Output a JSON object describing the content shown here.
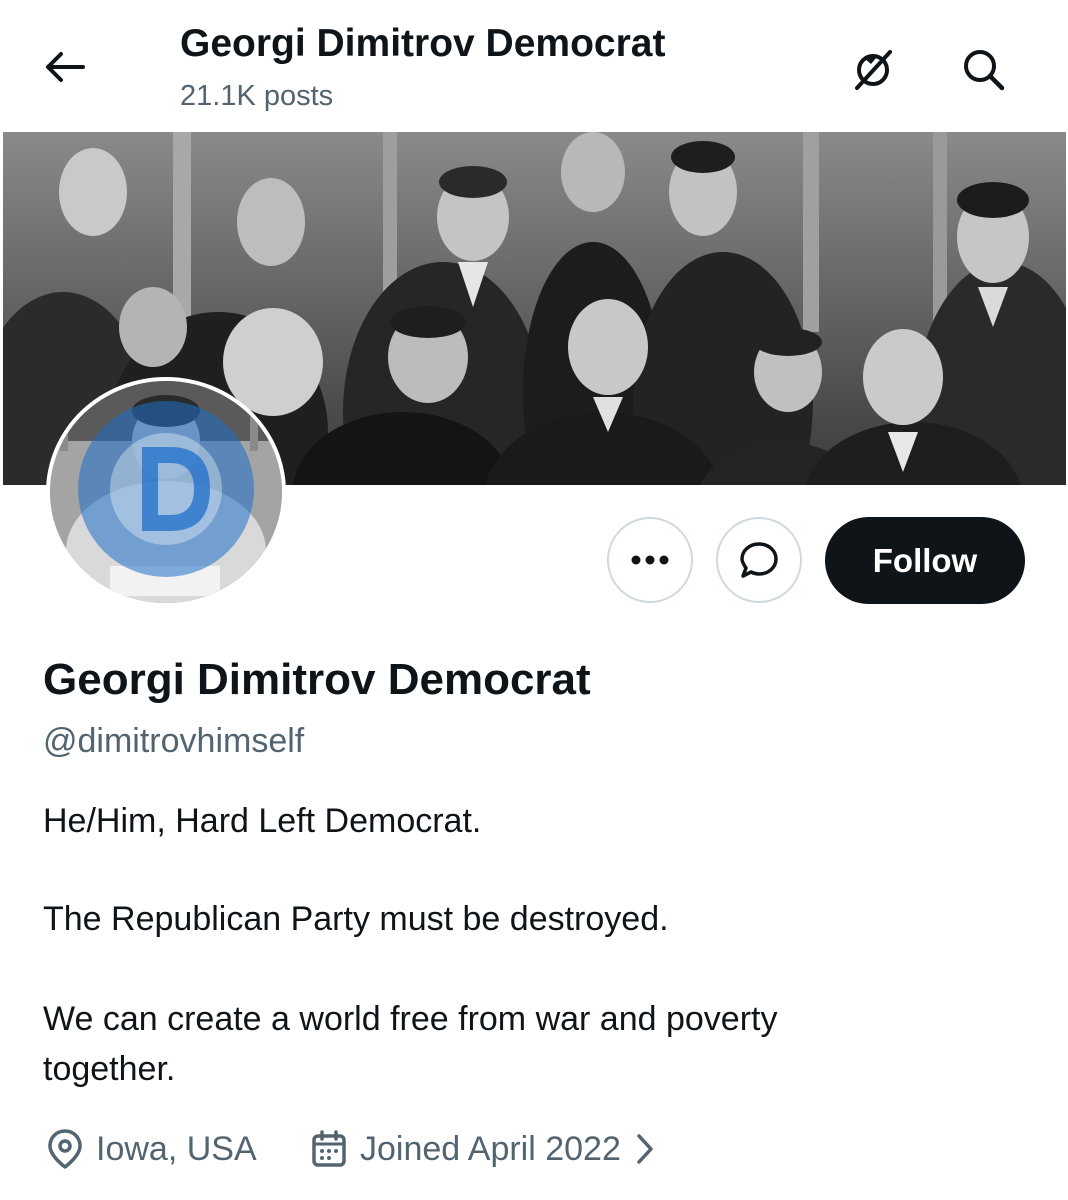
{
  "header": {
    "title": "Georgi Dimitrov Democrat",
    "posts": "21.1K posts",
    "back_icon": "arrow-left-icon",
    "translate_icon": "translate-icon",
    "search_icon": "search-icon"
  },
  "profile": {
    "name": "Georgi Dimitrov Democrat",
    "handle": "@dimitrovhimself",
    "bio": [
      "He/Him, Hard Left Democrat.",
      "The Republican Party must be destroyed.",
      "We can create a world free from war and poverty",
      "together."
    ],
    "location": "Iowa, USA",
    "joined": "Joined April 2022"
  },
  "actions": {
    "more_icon": "more-dots-icon",
    "message_icon": "message-icon",
    "follow_label": "Follow"
  },
  "colors": {
    "text": "#0f1419",
    "muted": "#536471",
    "border": "#cfd9de",
    "follow_bg": "#0f1419",
    "avatar_overlay": "#1d6fc9"
  }
}
